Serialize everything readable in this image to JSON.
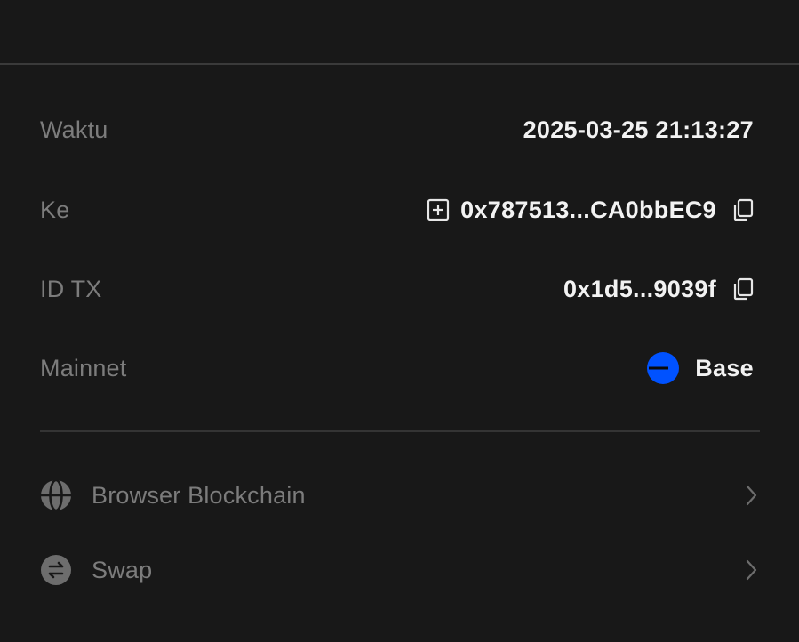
{
  "details": {
    "time": {
      "label": "Waktu",
      "value": "2025-03-25 21:13:27"
    },
    "to": {
      "label": "Ke",
      "value": "0x787513...CA0bbEC9",
      "add_icon": "add-contact-icon",
      "copy_icon": "copy-icon"
    },
    "txid": {
      "label": "ID TX",
      "value": "0x1d5...9039f",
      "copy_icon": "copy-icon"
    },
    "network": {
      "label": "Mainnet",
      "value": "Base",
      "icon": "base-network-icon",
      "icon_color": "#0052ff"
    }
  },
  "links": [
    {
      "label": "Browser Blockchain",
      "icon": "globe-icon"
    },
    {
      "label": "Swap",
      "icon": "swap-icon"
    }
  ],
  "colors": {
    "background": "#181818",
    "label": "#7c7c7c",
    "value": "#f2f2f2",
    "divider": "#3a3a3a"
  }
}
